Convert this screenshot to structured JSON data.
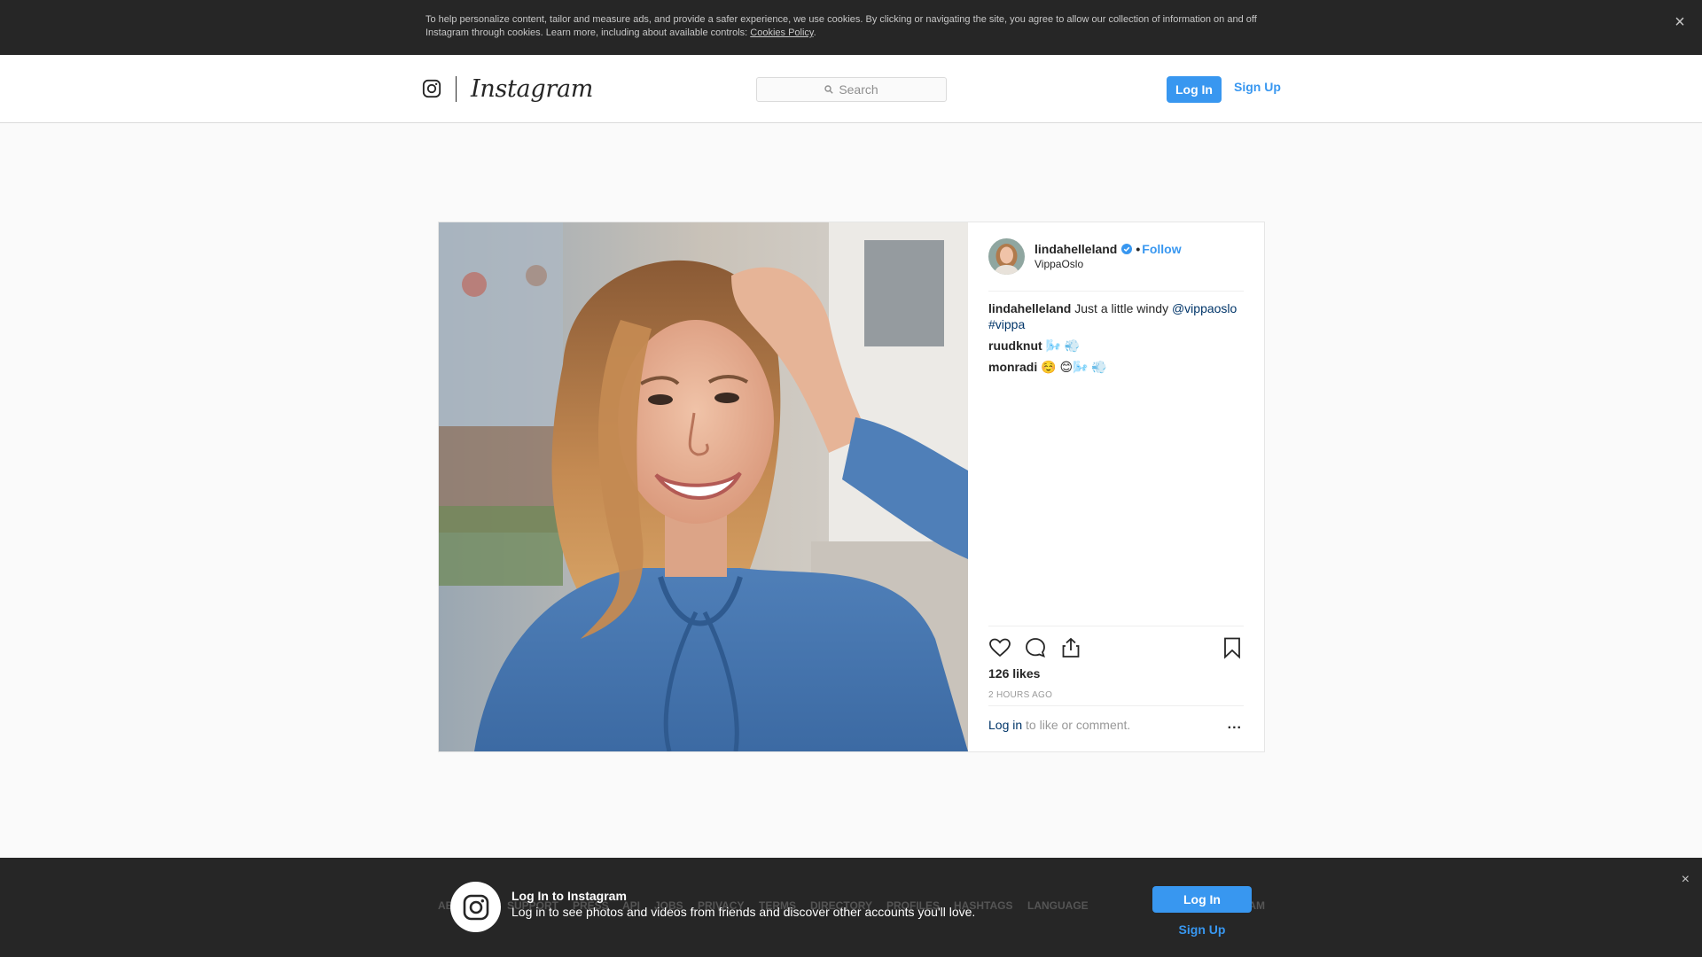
{
  "cookie_banner": {
    "text": "To help personalize content, tailor and measure ads, and provide a safer experience, we use cookies. By clicking or navigating the site, you agree to allow our collection of information on and off Instagram through cookies. Learn more, including about available controls: ",
    "link": "Cookies Policy",
    "end": ".",
    "close_icon": "×"
  },
  "header": {
    "wordmark": "Instagram",
    "search_placeholder": "Search",
    "login_label": "Log In",
    "signup_label": "Sign Up"
  },
  "post": {
    "username": "lindahelleland",
    "dot": "•",
    "follow_label": "Follow",
    "location": "VippaOslo",
    "caption": {
      "user": "lindahelleland",
      "text": " Just a little windy ",
      "mention": "@vippaoslo",
      "hashtag": "#vippa"
    },
    "comments": [
      {
        "user": "ruudknut",
        "text": " 🌬️ 💨"
      },
      {
        "user": "monradi",
        "text": " ☺️ 😊🌬️ 💨"
      }
    ],
    "likes": "126 likes",
    "time": "2 HOURS AGO",
    "login_link": "Log in",
    "login_rest": " to like or comment.",
    "more_icon": "..."
  },
  "footer_links": [
    "ABOUT US",
    "SUPPORT",
    "PRESS",
    "API",
    "JOBS",
    "PRIVACY",
    "TERMS",
    "DIRECTORY",
    "PROFILES",
    "HASHTAGS",
    "LANGUAGE"
  ],
  "footer_copyright": "© 2018 INSTAGRAM",
  "bottom_bar": {
    "title": "Log In to Instagram",
    "subtitle": "Log in to see photos and videos from friends and discover other accounts you'll love.",
    "login_label": "Log In",
    "signup_label": "Sign Up",
    "close_icon": "×"
  },
  "colors": {
    "accent": "#3897f0",
    "link": "#003569",
    "dark_bar": "#262626"
  }
}
